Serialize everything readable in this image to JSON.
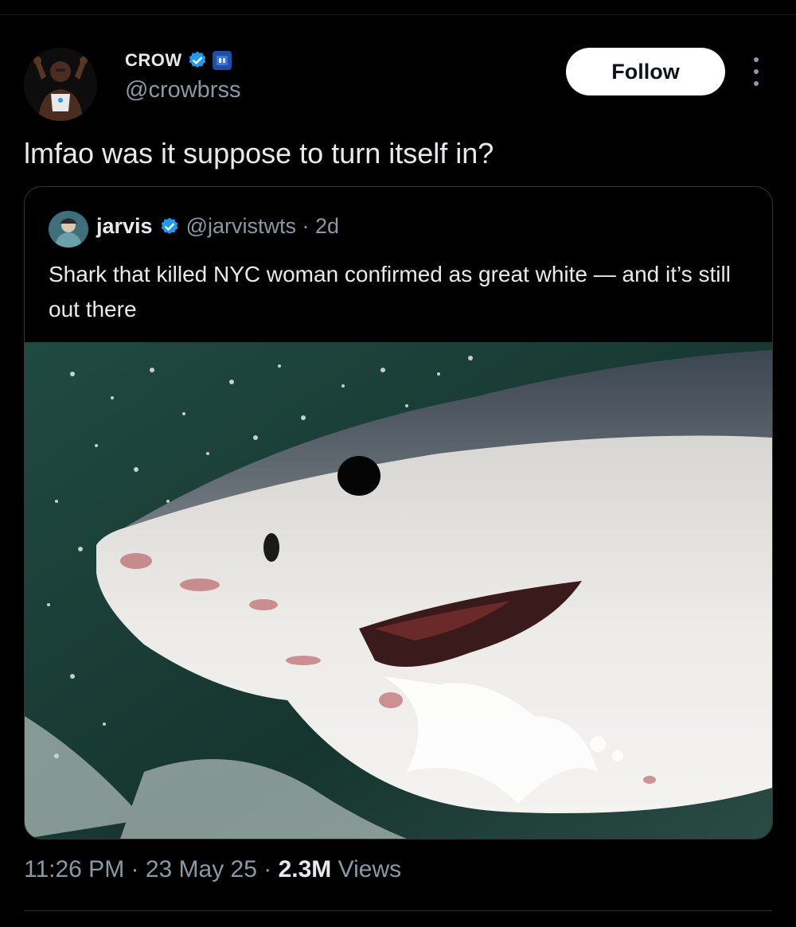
{
  "author": {
    "display_name": "CROW",
    "handle": "@crowbrss",
    "verified_icon": "verified-badge-icon",
    "affiliation_icon": "affiliation-badge-icon"
  },
  "actions": {
    "follow_label": "Follow",
    "more_icon": "more-dots-icon"
  },
  "tweet": {
    "text": "lmfao was it suppose to turn itself in?"
  },
  "quoted_tweet": {
    "display_name": "jarvis",
    "handle_time": "@jarvistwts · 2d",
    "text": "Shark that killed NYC woman confirmed as great white — and it’s still out there",
    "image_icon": "great-white-shark-photo"
  },
  "meta": {
    "time_date": "11:26 PM · 23 May 25 · ",
    "views_count": "2.3M",
    "views_label": " Views"
  },
  "colors": {
    "background": "#000000",
    "text_primary": "#e7e9ea",
    "text_secondary": "#8b98a5",
    "verified_blue": "#1d9bf0",
    "border": "#333333"
  }
}
